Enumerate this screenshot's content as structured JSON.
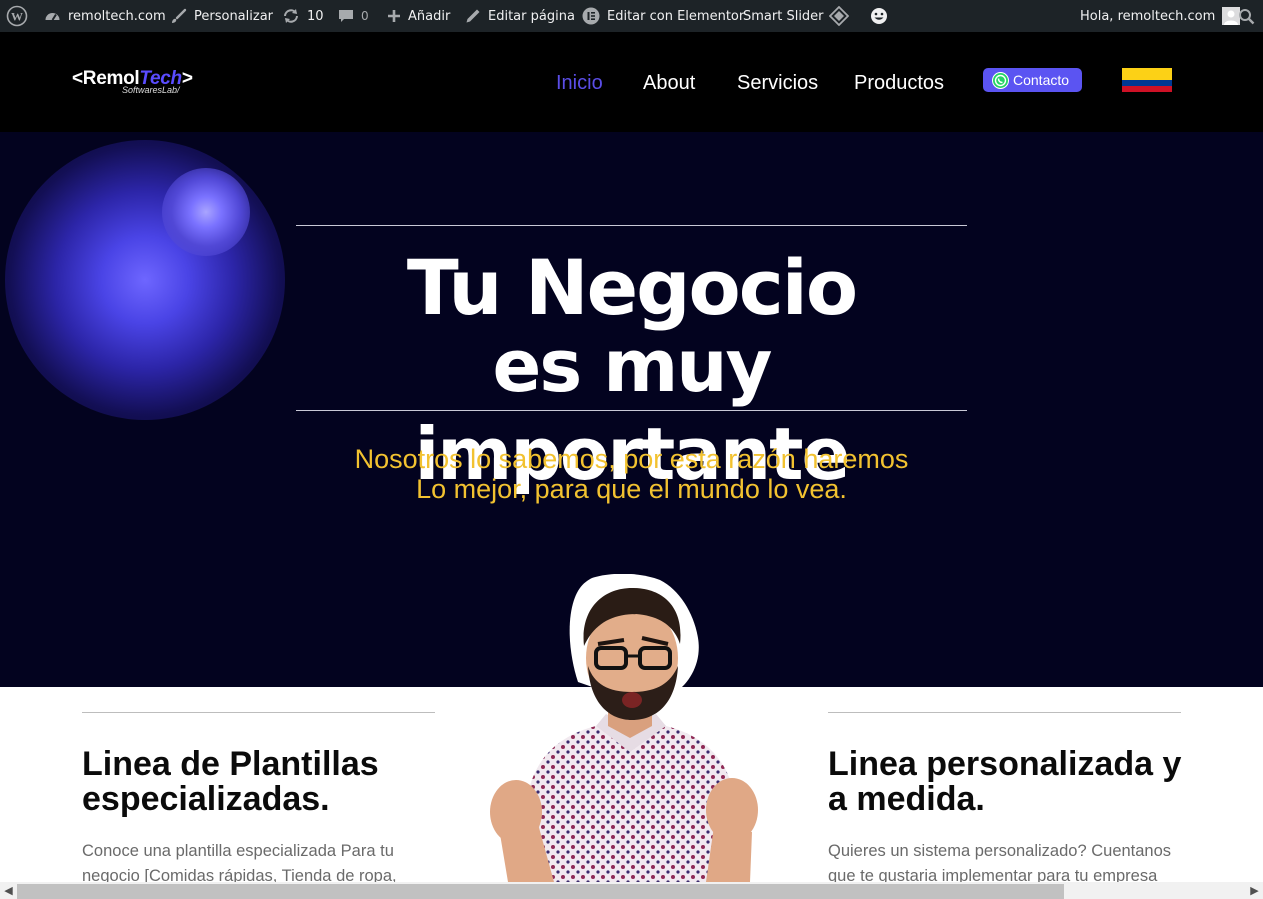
{
  "adminbar": {
    "site": "remoltech.com",
    "customize": "Personalizar",
    "updates": "10",
    "comments": "0",
    "add_new": "Añadir",
    "edit_page": "Editar página",
    "edit_elementor": "Editar con Elementor",
    "smart_slider": "Smart Slider",
    "greeting": "Hola, remoltech.com"
  },
  "header": {
    "logo_main_a": "<Remol",
    "logo_main_b": "Tech",
    "logo_main_c": ">",
    "logo_sub": "SoftwaresLab/",
    "nav": [
      "Inicio",
      "About",
      "Servicios",
      "Productos"
    ],
    "contact": "Contacto",
    "flag_colors": [
      "#fcd116",
      "#003893",
      "#ce1126"
    ]
  },
  "hero": {
    "title_line1": "Tu Negocio",
    "title_line2": "es muy importante",
    "subtitle_line1": "Nosotros lo sabemos, por esta razón haremos",
    "subtitle_line2": "Lo mejor, para que el mundo lo vea."
  },
  "columns": {
    "left_title_1": "Linea de Plantillas",
    "left_title_2": "especializadas.",
    "left_text_1": "Conoce una plantilla especializada Para tu",
    "left_text_2": "negocio [Comidas rápidas, Tienda de ropa,",
    "right_title_1": "Linea personalizada y",
    "right_title_2": "a medida.",
    "right_text_1": "Quieres un sistema personalizado? Cuentanos",
    "right_text_2": "que te gustaria implementar para tu empresa"
  },
  "colors": {
    "adminbar_bg": "#1d2327",
    "header_bg": "#000000",
    "hero_bg": "#03031f",
    "accent": "#5b4ee8",
    "subtitle": "#f2c230"
  }
}
